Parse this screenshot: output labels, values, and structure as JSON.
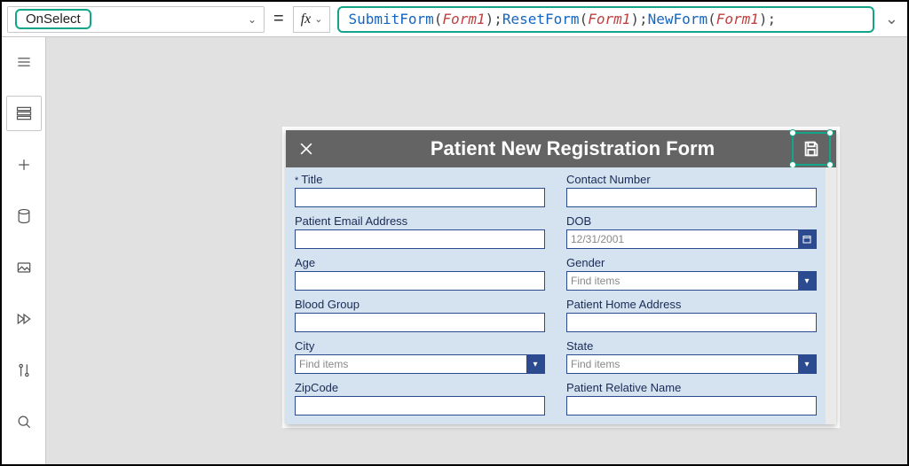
{
  "formulaBar": {
    "property": "OnSelect",
    "equals": "=",
    "fx": "fx",
    "formula": {
      "tokens": [
        {
          "t": "fn",
          "v": "SubmitForm"
        },
        {
          "t": "p",
          "v": "("
        },
        {
          "t": "it",
          "v": "Form1"
        },
        {
          "t": "p",
          "v": "); "
        },
        {
          "t": "fn",
          "v": "ResetForm"
        },
        {
          "t": "p",
          "v": "("
        },
        {
          "t": "it",
          "v": "Form1"
        },
        {
          "t": "p",
          "v": "); "
        },
        {
          "t": "fn",
          "v": "NewForm"
        },
        {
          "t": "p",
          "v": "("
        },
        {
          "t": "it",
          "v": "Form1"
        },
        {
          "t": "p",
          "v": ");"
        }
      ]
    }
  },
  "rail": {
    "icons": [
      "hamburger",
      "tree-view",
      "insert",
      "data",
      "media",
      "advanced",
      "variables",
      "search"
    ]
  },
  "screen": {
    "title": "Patient New Registration Form"
  },
  "form": {
    "left": [
      {
        "label": "Title",
        "type": "text",
        "required": true,
        "value": ""
      },
      {
        "label": "Patient Email Address",
        "type": "text",
        "value": ""
      },
      {
        "label": "Age",
        "type": "text",
        "value": ""
      },
      {
        "label": "Blood Group",
        "type": "text",
        "value": ""
      },
      {
        "label": "City",
        "type": "combo",
        "placeholder": "Find items"
      },
      {
        "label": "ZipCode",
        "type": "text",
        "value": ""
      }
    ],
    "right": [
      {
        "label": "Contact Number",
        "type": "text",
        "value": ""
      },
      {
        "label": "DOB",
        "type": "date",
        "value": "12/31/2001"
      },
      {
        "label": "Gender",
        "type": "combo",
        "placeholder": "Find items"
      },
      {
        "label": "Patient Home Address",
        "type": "text",
        "value": ""
      },
      {
        "label": "State",
        "type": "combo",
        "placeholder": "Find items"
      },
      {
        "label": "Patient Relative Name",
        "type": "text",
        "value": ""
      }
    ]
  }
}
